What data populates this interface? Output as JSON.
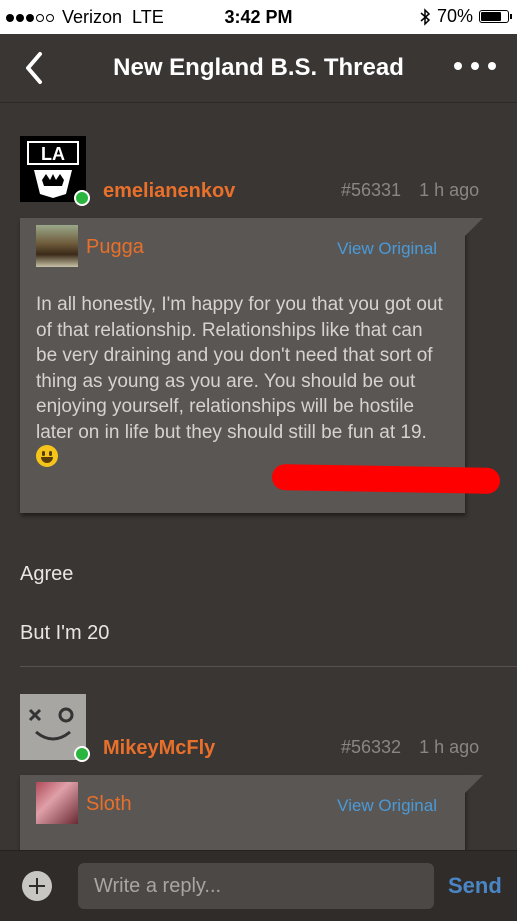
{
  "status_bar": {
    "carrier": "Verizon",
    "network": "LTE",
    "time": "3:42 PM",
    "battery": "70%",
    "battery_level": 0.7
  },
  "nav": {
    "title": "New England B.S. Thread",
    "back_icon": "chevron-left-icon",
    "more_icon": "ellipsis-icon"
  },
  "posts": [
    {
      "username": "emelianenkov",
      "post_number": "#56331",
      "time": "1 h ago",
      "online": true,
      "avatar": "la-kings-logo",
      "quote": {
        "author": "Pugga",
        "view_label": "View Original",
        "text": "In all honestly, I'm happy for you that you got out of that relationship.  Relationships like that can be very draining and you don't need that sort of thing as young as you are.  You should be out enjoying yourself, relationships will be hostile later on in life but they should still be fun at 19.",
        "emoji": "grinning-face"
      },
      "body": [
        "Agree",
        "But I'm 20"
      ]
    },
    {
      "username": "MikeyMcFly",
      "post_number": "#56332",
      "time": "1 h ago",
      "online": true,
      "avatar": "winking-face-avatar",
      "quote": {
        "author": "Sloth",
        "view_label": "View Original"
      }
    }
  ],
  "composer": {
    "placeholder": "Write a reply...",
    "send_label": "Send"
  },
  "colors": {
    "accent": "#e8702a",
    "link": "#4a9ad8",
    "background": "#3a3634",
    "annotation": "#ff0000"
  }
}
